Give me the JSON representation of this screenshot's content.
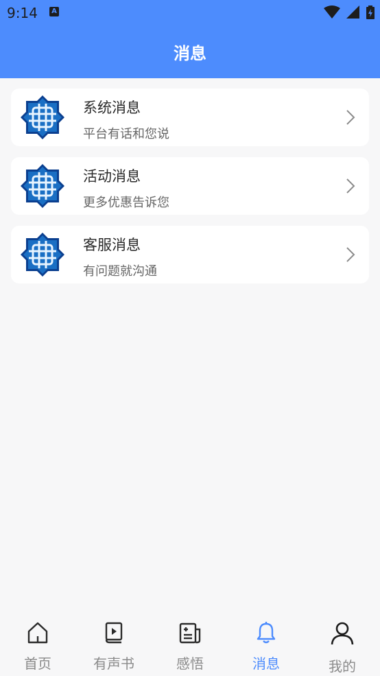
{
  "status_bar": {
    "time": "9:14",
    "indicator": "A"
  },
  "header": {
    "title": "消息"
  },
  "messages": [
    {
      "title": "系统消息",
      "subtitle": "平台有话和您说",
      "icon": "knot-logo-icon"
    },
    {
      "title": "活动消息",
      "subtitle": "更多优惠告诉您",
      "icon": "knot-logo-icon"
    },
    {
      "title": "客服消息",
      "subtitle": "有问题就沟通",
      "icon": "knot-logo-icon"
    }
  ],
  "tabbar": {
    "items": [
      {
        "label": "首页",
        "icon": "home-icon",
        "active": false
      },
      {
        "label": "有声书",
        "icon": "audiobook-icon",
        "active": false
      },
      {
        "label": "感悟",
        "icon": "notes-icon",
        "active": false
      },
      {
        "label": "消息",
        "icon": "bell-icon",
        "active": true
      },
      {
        "label": "我的",
        "icon": "user-icon",
        "active": false
      }
    ]
  },
  "colors": {
    "brand": "#4d8cfd",
    "inactive_tab": "#8a8a8a",
    "background": "#f7f7f8"
  }
}
